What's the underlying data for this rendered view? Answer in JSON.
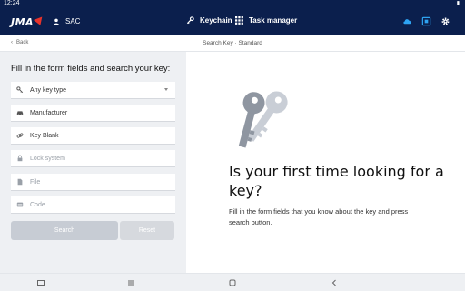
{
  "status": {
    "time": "12:24"
  },
  "header": {
    "logo_text": "JMA",
    "user_label": "SAC",
    "nav": [
      {
        "label": "Keychain",
        "icon": "keychain-icon"
      },
      {
        "label": "Task manager",
        "icon": "grid-icon"
      }
    ],
    "actions": [
      "cloud-icon",
      "window-icon",
      "gear-icon"
    ],
    "accent_color": "#2ea3f2",
    "bg_color": "#0b1f4d"
  },
  "subheader": {
    "back_label": "Back",
    "title": "Search Key · Standard"
  },
  "form": {
    "title": "Fill in the form fields and search your key:",
    "fields": [
      {
        "label": "Any key type",
        "icon": "key-icon",
        "type": "select"
      },
      {
        "label": "Manufacturer",
        "icon": "car-icon",
        "type": "input"
      },
      {
        "label": "Key Blank",
        "icon": "link-icon",
        "type": "input"
      },
      {
        "label": "Lock system",
        "icon": "lock-icon",
        "type": "input",
        "disabled": true
      },
      {
        "label": "File",
        "icon": "file-icon",
        "type": "input",
        "disabled": true
      },
      {
        "label": "Code",
        "icon": "code-icon",
        "type": "input",
        "disabled": true
      }
    ],
    "search_label": "Search",
    "reset_label": "Reset"
  },
  "info": {
    "headline": "Is your first time looking for a key?",
    "description": "Fill in the form fields that you know about the key and press search button."
  }
}
